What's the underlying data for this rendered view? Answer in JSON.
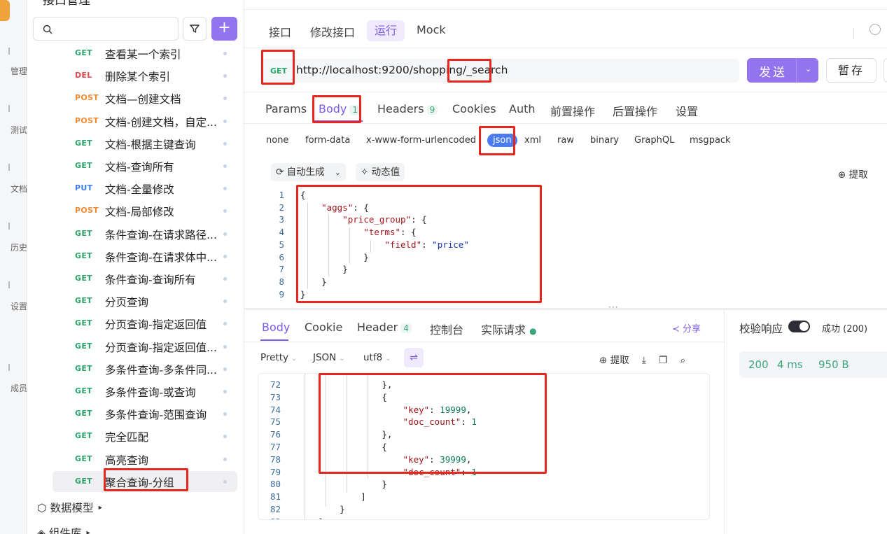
{
  "rail": {
    "items": [
      "管理",
      "测试",
      "文档",
      "历史",
      "设置",
      "成员"
    ]
  },
  "tree": {
    "title": "接口管理",
    "search_placeholder": "",
    "add_label": "+",
    "items": [
      {
        "method": "GET",
        "label": "查看某一个索引"
      },
      {
        "method": "DEL",
        "label": "删除某个索引"
      },
      {
        "method": "POST",
        "label": "文档—创建文档"
      },
      {
        "method": "POST",
        "label": "文档-创建文档，自定..."
      },
      {
        "method": "GET",
        "label": "文档-根据主键查询"
      },
      {
        "method": "GET",
        "label": "文档-查询所有"
      },
      {
        "method": "PUT",
        "label": "文档-全量修改"
      },
      {
        "method": "POST",
        "label": "文档-局部修改"
      },
      {
        "method": "GET",
        "label": "条件查询-在请求路径..."
      },
      {
        "method": "GET",
        "label": "条件查询-在请求体中..."
      },
      {
        "method": "GET",
        "label": "条件查询-查询所有"
      },
      {
        "method": "GET",
        "label": "分页查询"
      },
      {
        "method": "GET",
        "label": "分页查询-指定返回值"
      },
      {
        "method": "GET",
        "label": "分页查询-指定返回值..."
      },
      {
        "method": "GET",
        "label": "多条件查询-多条件同..."
      },
      {
        "method": "GET",
        "label": "多条件查询-或查询"
      },
      {
        "method": "GET",
        "label": "多条件查询-范围查询"
      },
      {
        "method": "GET",
        "label": "完全匹配"
      },
      {
        "method": "GET",
        "label": "高亮查询"
      },
      {
        "method": "GET",
        "label": "聚合查询-分组"
      }
    ],
    "folders": [
      "数据模型 ‣",
      "组件库 ‣"
    ]
  },
  "main": {
    "subtabs": [
      "接口",
      "修改接口",
      "运行",
      "Mock"
    ],
    "url": {
      "method": "GET",
      "value": "http://localhost:9200/shopping/_search"
    },
    "send_label": "发送",
    "send_dropdown": "⌄",
    "save_label": "暂存",
    "request_tabs": {
      "params": "Params",
      "body": "Body",
      "body_count": "1",
      "headers": "Headers",
      "headers_count": "9",
      "cookies": "Cookies",
      "auth": "Auth",
      "pre": "前置操作",
      "post": "后置操作",
      "settings": "设置"
    },
    "body_types": [
      "none",
      "form-data",
      "x-www-form-urlencoded",
      "json",
      "xml",
      "raw",
      "binary",
      "GraphQL",
      "msgpack"
    ],
    "editor_tools": {
      "auto": "自动生成",
      "dynamic": "动态值",
      "extract": "提取"
    },
    "request_body": [
      {
        "ln": "1",
        "text": "{"
      },
      {
        "ln": "2",
        "text": "    \"aggs\": {"
      },
      {
        "ln": "3",
        "text": "        \"price_group\": {"
      },
      {
        "ln": "4",
        "text": "            \"terms\": {"
      },
      {
        "ln": "5",
        "text": "                \"field\": \"price\""
      },
      {
        "ln": "6",
        "text": "            }"
      },
      {
        "ln": "7",
        "text": "        }"
      },
      {
        "ln": "8",
        "text": "    }"
      },
      {
        "ln": "9",
        "text": "}"
      }
    ],
    "response_tabs": {
      "body": "Body",
      "cookie": "Cookie",
      "header": "Header",
      "header_count": "4",
      "console": "控制台",
      "actual": "实际请求"
    },
    "share_label": "分享",
    "response_format": {
      "pretty": "Pretty",
      "json": "JSON",
      "enc": "utf8"
    },
    "response_tools": {
      "extract": "提取"
    },
    "response_body": [
      {
        "ln": "72",
        "text": "                },"
      },
      {
        "ln": "73",
        "text": "                {"
      },
      {
        "ln": "74",
        "text": "                    \"key\": 19999,"
      },
      {
        "ln": "75",
        "text": "                    \"doc_count\": 1"
      },
      {
        "ln": "76",
        "text": "                },"
      },
      {
        "ln": "77",
        "text": "                {"
      },
      {
        "ln": "78",
        "text": "                    \"key\": 39999,"
      },
      {
        "ln": "79",
        "text": "                    \"doc_count\": 1"
      },
      {
        "ln": "80",
        "text": "                }"
      },
      {
        "ln": "81",
        "text": "            ]"
      },
      {
        "ln": "82",
        "text": "        }"
      },
      {
        "ln": "83",
        "text": "    }"
      }
    ],
    "verify_label": "校验响应",
    "status_label": "成功 (200)",
    "status": {
      "code": "200",
      "time": "4 ms",
      "size": "950 B"
    }
  },
  "colors": {
    "accent": "#9373ee",
    "annotation": "#e8261c",
    "get": "#2aa568",
    "post": "#f28a30",
    "del": "#e44a4a",
    "put": "#3b7dea"
  }
}
